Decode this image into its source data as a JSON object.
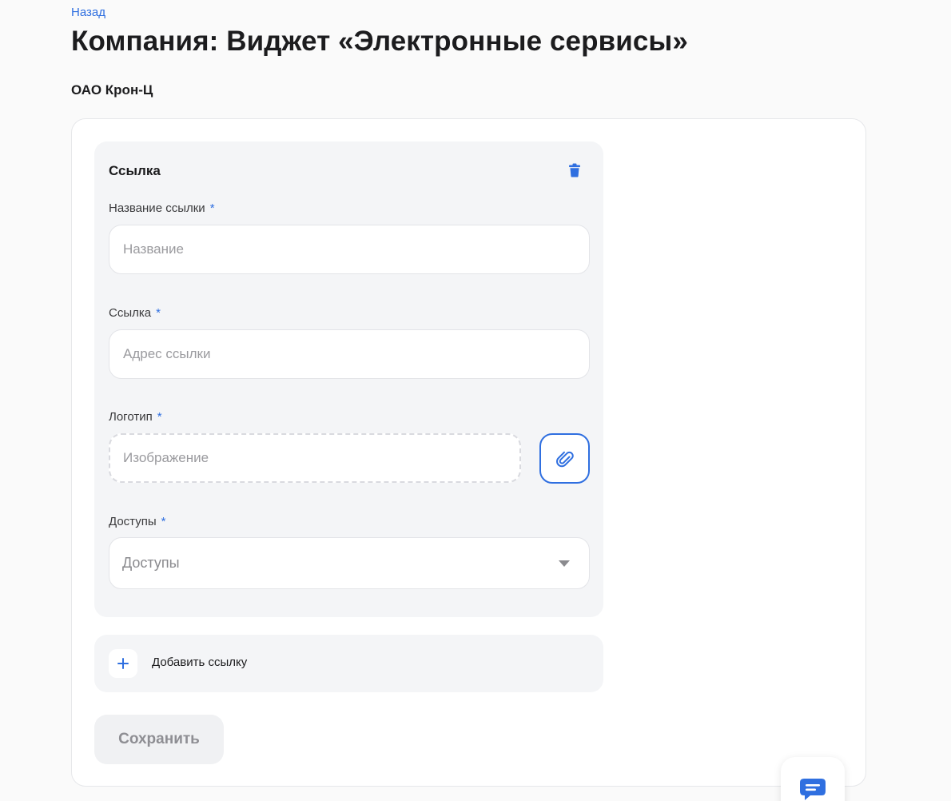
{
  "header": {
    "back_label": "Назад",
    "title": "Компания: Виджет «Электронные сервисы»",
    "company": "ОАО Крон-Ц"
  },
  "link_block": {
    "title": "Ссылка",
    "name_field": {
      "label": "Название ссылки",
      "required": "*",
      "placeholder": "Название",
      "value": ""
    },
    "url_field": {
      "label": "Ссылка",
      "required": "*",
      "placeholder": "Адрес ссылки",
      "value": ""
    },
    "logo_field": {
      "label": "Логотип",
      "required": "*",
      "placeholder": "Изображение",
      "value": ""
    },
    "access_field": {
      "label": "Доступы",
      "required": "*",
      "selected": "Доступы"
    },
    "icons": {
      "delete": "trash-icon",
      "attach": "paperclip-icon",
      "dropdown": "chevron-down-icon"
    }
  },
  "add_link": {
    "label": "Добавить ссылку",
    "icon": "plus-icon"
  },
  "save_label": "Сохранить",
  "chat_icon": "chat-bubble-icon",
  "colors": {
    "accent": "#2f6fe0",
    "background": "#fafafa",
    "card": "#ffffff",
    "block": "#f4f5f7",
    "text": "#1c1c1e",
    "placeholder": "#9a9a9e"
  }
}
